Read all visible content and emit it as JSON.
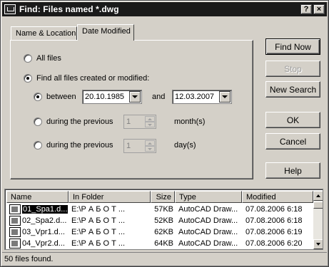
{
  "window": {
    "title": "Find: Files named *.dwg",
    "help_button": "?",
    "close_button": "×"
  },
  "tabs": [
    {
      "label": "Name & Location"
    },
    {
      "label": "Date Modified"
    }
  ],
  "date_panel": {
    "all_files_label": "All files",
    "find_all_label": "Find all files created or modified:",
    "between_label": "between",
    "from_date": "20.10.1985",
    "and_label": "and",
    "to_date": "12.03.2007",
    "prev_months_label": "during the previous",
    "months_value": "1",
    "months_unit": "month(s)",
    "prev_days_label": "during the previous",
    "days_value": "1",
    "days_unit": "day(s)"
  },
  "buttons": {
    "find_now": "Find Now",
    "stop": "Stop",
    "new_search": "New Search",
    "ok": "OK",
    "cancel": "Cancel",
    "help": "Help"
  },
  "results": {
    "columns": [
      "Name",
      "In Folder",
      "Size",
      "Type",
      "Modified"
    ],
    "rows": [
      {
        "name": "01_Spa1.d...",
        "folder": "E:\\Р А Б О Т ...",
        "size": "57KB",
        "type": "AutoCAD Draw...",
        "modified": "07.08.2006 6:18"
      },
      {
        "name": "02_Spa2.d...",
        "folder": "E:\\Р А Б О Т ...",
        "size": "52KB",
        "type": "AutoCAD Draw...",
        "modified": "07.08.2006 6:18"
      },
      {
        "name": "03_Vpr1.d...",
        "folder": "E:\\Р А Б О Т ...",
        "size": "62KB",
        "type": "AutoCAD Draw...",
        "modified": "07.08.2006 6:19"
      },
      {
        "name": "04_Vpr2.d...",
        "folder": "E:\\Р А Б О Т ...",
        "size": "64KB",
        "type": "AutoCAD Draw...",
        "modified": "07.08.2006 6:20"
      }
    ]
  },
  "status": {
    "text": "50 files found."
  }
}
